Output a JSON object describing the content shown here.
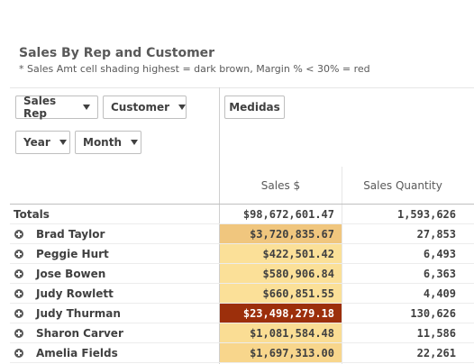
{
  "header": {
    "title": "Sales By Rep and Customer",
    "subtitle": "* Sales Amt cell shading highest = dark brown, Margin % < 30% = red"
  },
  "filters": {
    "sales_rep": "Sales Rep",
    "customer": "Customer",
    "year": "Year",
    "month": "Month",
    "measures": "Medidas"
  },
  "columns": {
    "sales": "Sales $",
    "quantity": "Sales Quantity"
  },
  "totals": {
    "label": "Totals",
    "sales": "$98,672,601.47",
    "quantity": "1,593,626"
  },
  "rows": [
    {
      "name": "Brad Taylor",
      "sales": "$3,720,835.67",
      "quantity": "27,853",
      "shade": "#f0c67e",
      "text": "#404040"
    },
    {
      "name": "Peggie Hurt",
      "sales": "$422,501.42",
      "quantity": "6,493",
      "shade": "#fbe098",
      "text": "#404040"
    },
    {
      "name": "Jose Bowen",
      "sales": "$580,906.84",
      "quantity": "6,363",
      "shade": "#fbe098",
      "text": "#404040"
    },
    {
      "name": "Judy Rowlett",
      "sales": "$660,851.55",
      "quantity": "4,409",
      "shade": "#fbe098",
      "text": "#404040"
    },
    {
      "name": "Judy Thurman",
      "sales": "$23,498,279.18",
      "quantity": "130,626",
      "shade": "#9c2f0b",
      "text": "#ffffff"
    },
    {
      "name": "Sharon Carver",
      "sales": "$1,081,584.48",
      "quantity": "11,586",
      "shade": "#fadd94",
      "text": "#404040"
    },
    {
      "name": "Amelia Fields",
      "sales": "$1,697,313.00",
      "quantity": "22,261",
      "shade": "#f8d68c",
      "text": "#404040"
    }
  ]
}
